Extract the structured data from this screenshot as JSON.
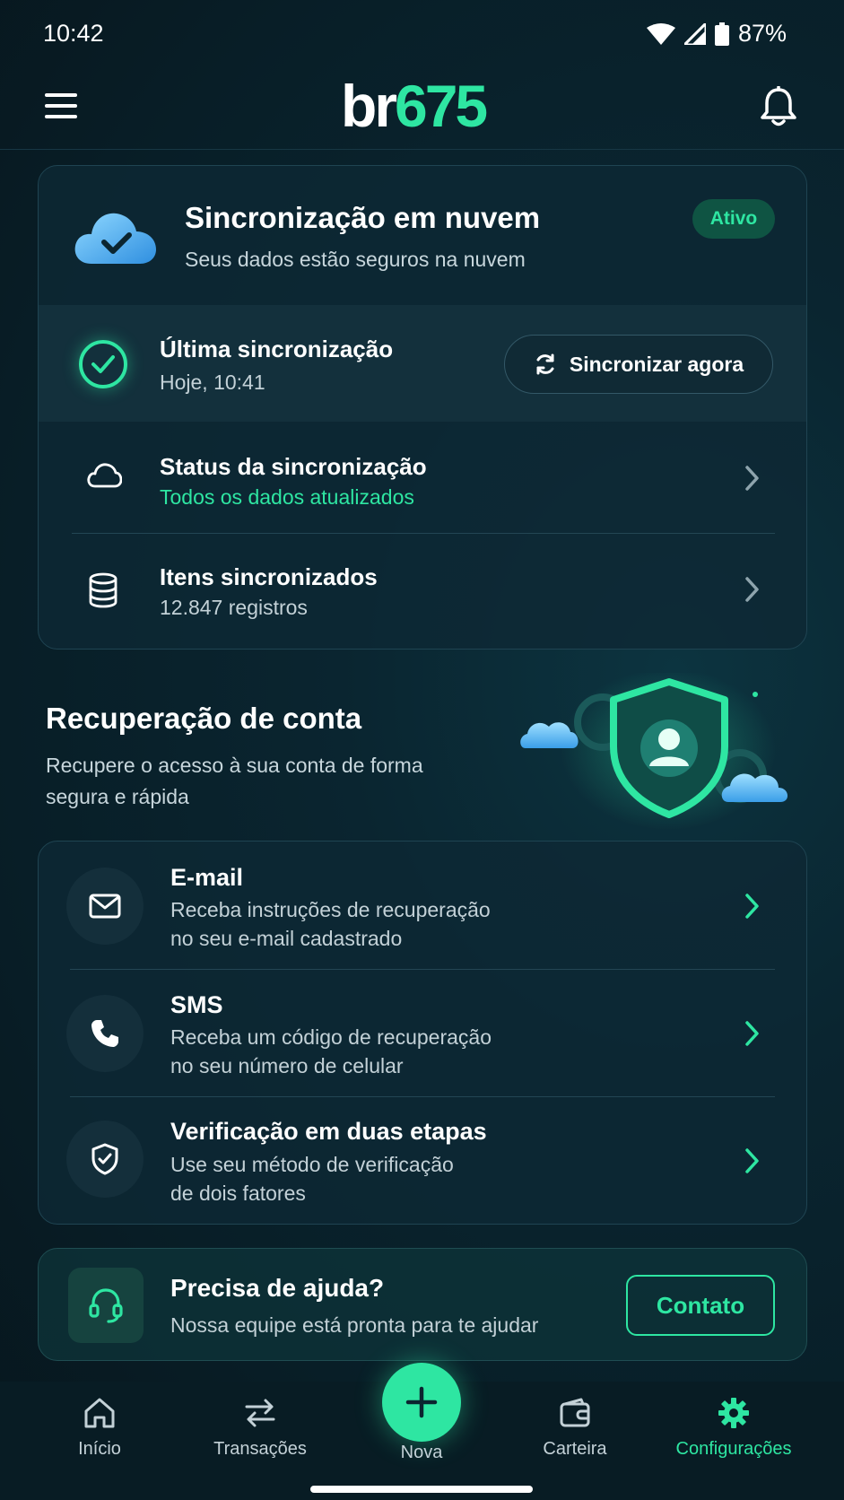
{
  "status_bar": {
    "time": "10:42",
    "battery": "87%"
  },
  "header": {
    "logo_part1": "br",
    "logo_part2": "675"
  },
  "sync_card": {
    "title": "Sincronização em nuvem",
    "subtitle": "Seus dados estão seguros na nuvem",
    "badge": "Ativo",
    "last_sync_label": "Última sincronização",
    "last_sync_value": "Hoje, 10:41",
    "sync_button": "Sincronizar agora",
    "rows": [
      {
        "title": "Status da sincronização",
        "subtitle": "Todos os dados atualizados"
      },
      {
        "title": "Itens sincronizados",
        "subtitle": "12.847 registros"
      }
    ]
  },
  "recovery": {
    "title": "Recuperação de conta",
    "subtitle": "Recupere o acesso à sua conta de forma segura e rápida",
    "options": [
      {
        "title": "E-mail",
        "desc1": "Receba instruções de recuperação",
        "desc2": "no seu e-mail cadastrado"
      },
      {
        "title": "SMS",
        "desc1": "Receba um código de recuperação",
        "desc2": "no seu número de celular"
      },
      {
        "title": "Verificação em duas etapas",
        "desc1": "Use seu método de verificação",
        "desc2": "de dois fatores"
      }
    ]
  },
  "help": {
    "title": "Precisa de ajuda?",
    "subtitle": "Nossa equipe está pronta para te ajudar",
    "button": "Contato"
  },
  "nav": {
    "items": [
      {
        "label": "Início",
        "icon": "home-icon"
      },
      {
        "label": "Transações",
        "icon": "transfer-icon"
      },
      {
        "label": "Nova",
        "icon": "plus-icon"
      },
      {
        "label": "Carteira",
        "icon": "wallet-icon"
      },
      {
        "label": "Configurações",
        "icon": "gear-icon",
        "active": true
      }
    ]
  },
  "colors": {
    "accent": "#2ee6a2",
    "background": "#081e27",
    "card": "#0e2834"
  }
}
